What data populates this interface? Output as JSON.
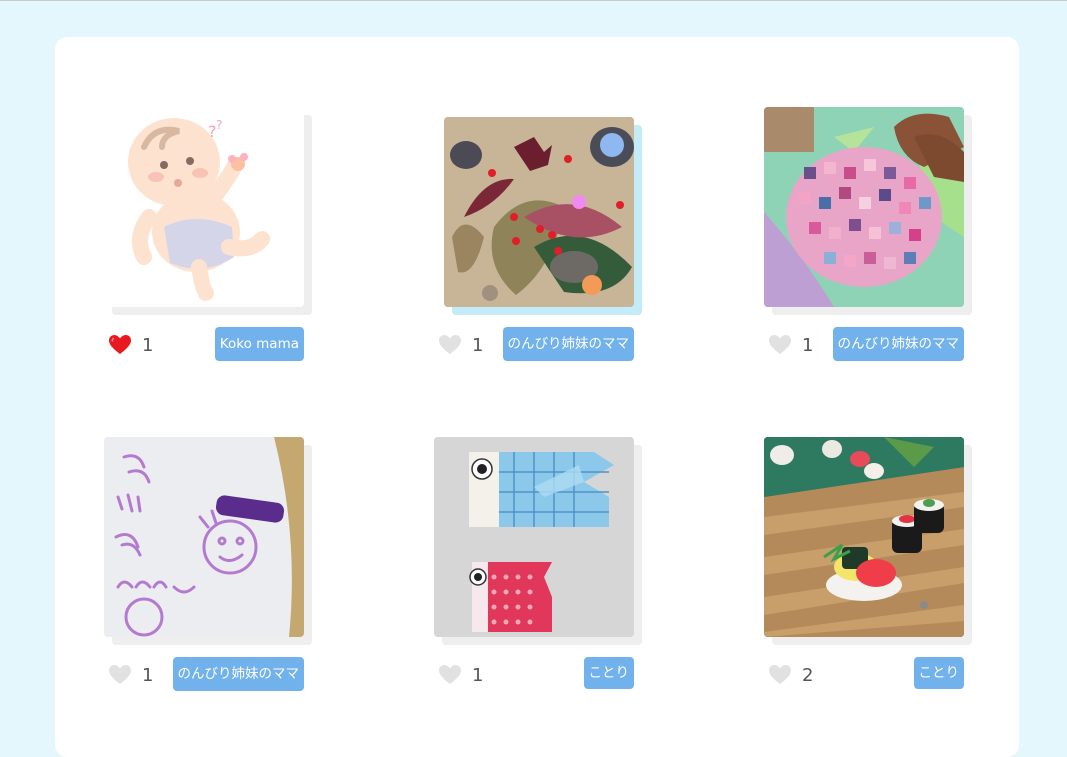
{
  "posts": [
    {
      "likes": "1",
      "liked": true,
      "author": "Koko mama",
      "image": "baby-illustration"
    },
    {
      "likes": "1",
      "liked": false,
      "author": "のんびり姉妹のママ",
      "image": "autumn-leaves-collage"
    },
    {
      "likes": "1",
      "liked": false,
      "author": "のんびり姉妹のママ",
      "image": "hydrangea-paper-collage"
    },
    {
      "likes": "1",
      "liked": false,
      "author": "のんびり姉妹のママ",
      "image": "crayon-drawing"
    },
    {
      "likes": "1",
      "liked": false,
      "author": "ことり",
      "image": "origami-carp-streamers"
    },
    {
      "likes": "2",
      "liked": false,
      "author": "ことり",
      "image": "clay-sushi"
    }
  ],
  "colors": {
    "page_bg": "#e4f7fd",
    "panel_bg": "#ffffff",
    "tag_bg": "#71b2ec",
    "heart_liked": "#e8191f",
    "heart_unliked": "#e1e1e1"
  }
}
